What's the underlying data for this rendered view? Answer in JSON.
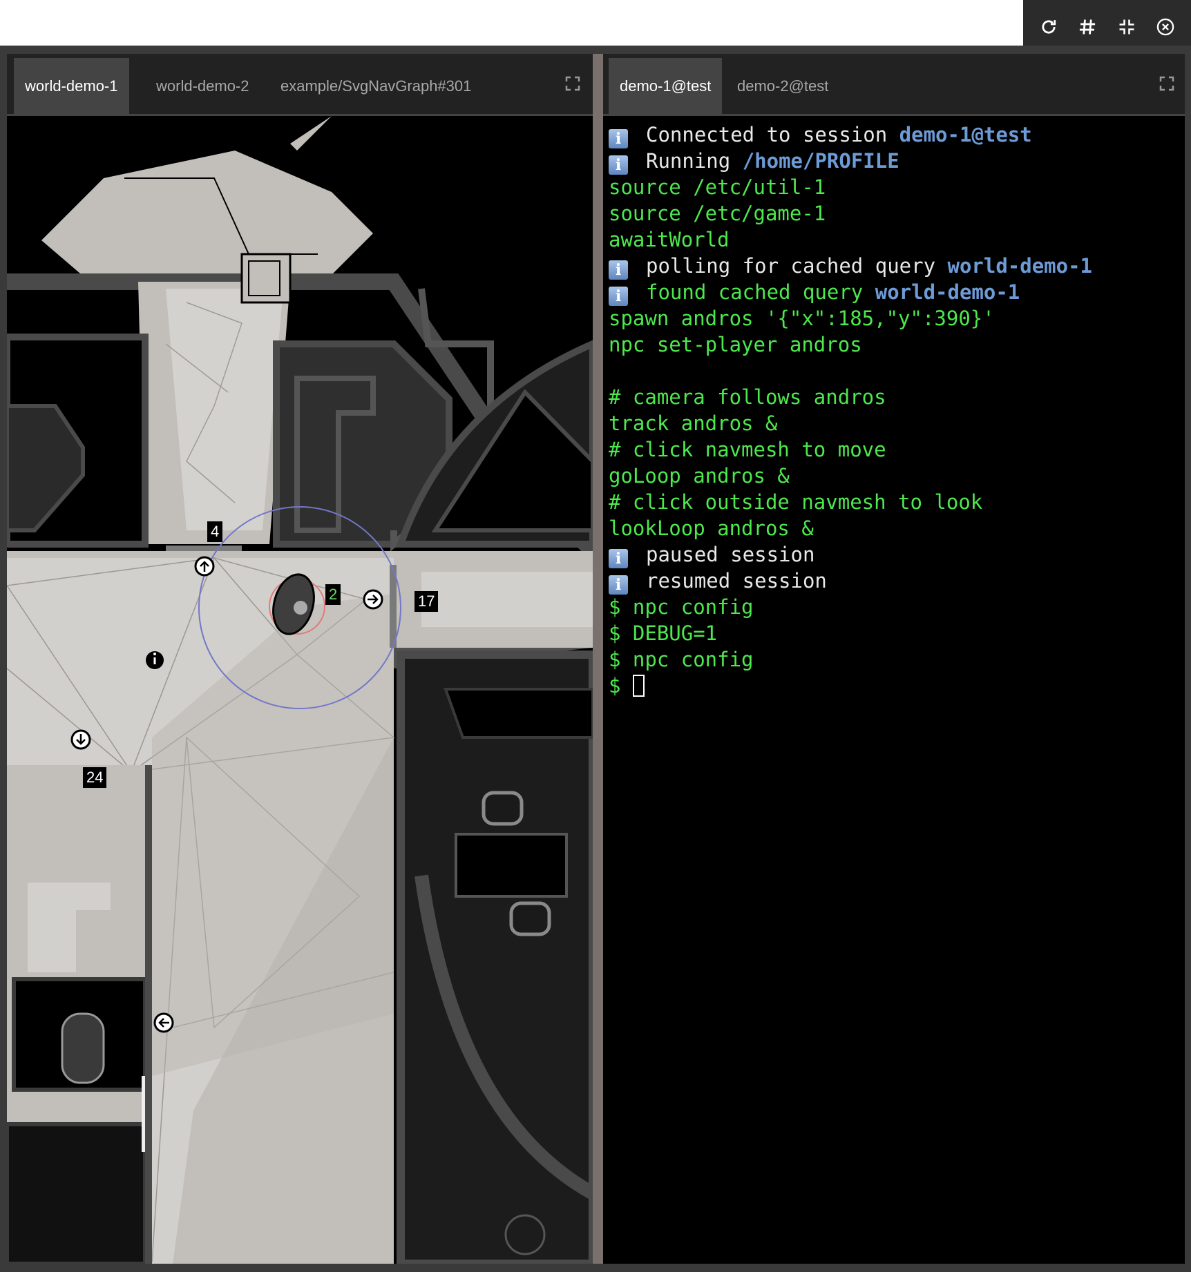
{
  "toolbar": {
    "buttons": [
      {
        "name": "refresh-icon"
      },
      {
        "name": "hash-icon"
      },
      {
        "name": "compress-icon"
      },
      {
        "name": "close-circle-icon"
      }
    ]
  },
  "left_pane": {
    "tabs": [
      {
        "label": "world-demo-1",
        "active": true
      },
      {
        "label": "world-demo-2",
        "active": false
      },
      {
        "label": "example/SvgNavGraph#301",
        "active": false
      }
    ],
    "world": {
      "door_labels": [
        "4",
        "17",
        "24"
      ],
      "npc_label": "2",
      "colors": {
        "floor": "#c2bfba",
        "navmesh": "#d6d4d0",
        "wall": "#4a4a4a",
        "void": "#000000"
      }
    }
  },
  "right_pane": {
    "tabs": [
      {
        "label": "demo-1@test",
        "active": true
      },
      {
        "label": "demo-2@test",
        "active": false
      }
    ],
    "terminal": {
      "l1_text": "Connected to session ",
      "l1_hl": "demo-1@test",
      "l2_text": "Running ",
      "l2_hl": "/home/PROFILE",
      "l3": "source /etc/util-1",
      "l4": "source /etc/game-1",
      "l5": "awaitWorld",
      "l6_text": "polling for cached query ",
      "l6_hl": "world-demo-1",
      "l7_text": "found cached query ",
      "l7_hl": "world-demo-1",
      "l8": "spawn andros '{\"x\":185,\"y\":390}'",
      "l9": "npc set-player andros",
      "l10": "# camera follows andros",
      "l11": "track andros &",
      "l12": "# click navmesh to move",
      "l13": "goLoop andros &",
      "l14": "# click outside navmesh to look",
      "l15": "lookLoop andros &",
      "l16": "paused session",
      "l17": "resumed session",
      "l18": "$ npc config",
      "l19": "$ DEBUG=1",
      "l20": "$ npc config",
      "prompt": "$ "
    }
  }
}
